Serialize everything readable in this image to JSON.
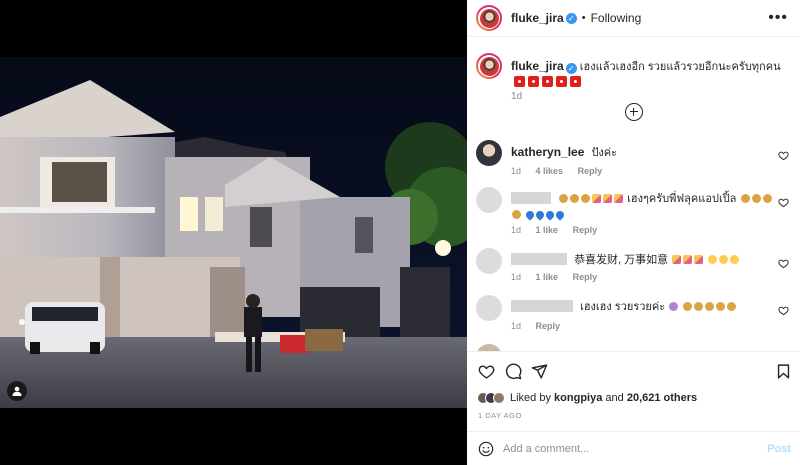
{
  "header": {
    "username": "fluke_jira",
    "verified_icon": "verified-badge-icon",
    "separator": "•",
    "follow_status": "Following",
    "more_icon": "more-options-icon"
  },
  "caption": {
    "username": "fluke_jira",
    "text": "เฮงแล้วเฮงอีก รวยแล้วรวยอีกนะครับทุกคน",
    "flag_icons": [
      "flag-icon",
      "flag-icon",
      "flag-icon",
      "flag-icon",
      "flag-icon"
    ],
    "time": "1d"
  },
  "load_more_icon": "plus-circle-icon",
  "comments": [
    {
      "username": "katheryn_lee",
      "text": "ปังค่ะ",
      "time": "1d",
      "likes": "4 likes",
      "reply": "Reply"
    },
    {
      "username_hidden": true,
      "text": "เฮงๆครับพี่ฟลุคแอปเปิ้ล",
      "time": "1d",
      "likes": "1 like",
      "reply": "Reply",
      "emoji_icons": [
        "money-bag-icon",
        "party-popper-icon",
        "blue-heart-icon"
      ]
    },
    {
      "username_hidden": true,
      "text": "恭喜发财, 万事如意",
      "time": "1d",
      "likes": "1 like",
      "reply": "Reply"
    },
    {
      "username_hidden": true,
      "text": "เฮงเฮง รวยรวยค่ะ",
      "time": "1d",
      "likes": "",
      "reply": "Reply"
    }
  ],
  "actions": {
    "like_icon": "heart-icon",
    "comment_icon": "comment-bubble-icon",
    "share_icon": "send-plane-icon",
    "save_icon": "bookmark-icon"
  },
  "likes": {
    "prefix": "Liked by",
    "user": "kongpiya",
    "joiner": "and",
    "others": "20,621 others"
  },
  "date": "1 DAY AGO",
  "add_comment": {
    "placeholder": "Add a comment...",
    "post_label": "Post",
    "emoji_icon": "smiley-face-icon"
  },
  "media": {
    "tag_icon": "user-tag-icon"
  },
  "colors": {
    "link_blue": "#3897f0",
    "post_disabled": "#b2dffc",
    "muted": "#8e8e8e"
  }
}
